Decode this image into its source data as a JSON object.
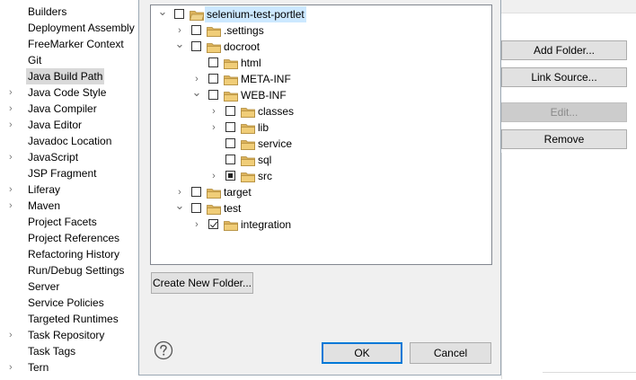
{
  "preferences": {
    "items": [
      {
        "label": "Builders",
        "expandable": false,
        "selected": false
      },
      {
        "label": "Deployment Assembly",
        "expandable": false,
        "selected": false
      },
      {
        "label": "FreeMarker Context",
        "expandable": false,
        "selected": false
      },
      {
        "label": "Git",
        "expandable": false,
        "selected": false
      },
      {
        "label": "Java Build Path",
        "expandable": false,
        "selected": true
      },
      {
        "label": "Java Code Style",
        "expandable": true,
        "selected": false
      },
      {
        "label": "Java Compiler",
        "expandable": true,
        "selected": false
      },
      {
        "label": "Java Editor",
        "expandable": true,
        "selected": false
      },
      {
        "label": "Javadoc Location",
        "expandable": false,
        "selected": false
      },
      {
        "label": "JavaScript",
        "expandable": true,
        "selected": false
      },
      {
        "label": "JSP Fragment",
        "expandable": false,
        "selected": false
      },
      {
        "label": "Liferay",
        "expandable": true,
        "selected": false
      },
      {
        "label": "Maven",
        "expandable": true,
        "selected": false
      },
      {
        "label": "Project Facets",
        "expandable": false,
        "selected": false
      },
      {
        "label": "Project References",
        "expandable": false,
        "selected": false
      },
      {
        "label": "Refactoring History",
        "expandable": false,
        "selected": false
      },
      {
        "label": "Run/Debug Settings",
        "expandable": false,
        "selected": false
      },
      {
        "label": "Server",
        "expandable": false,
        "selected": false
      },
      {
        "label": "Service Policies",
        "expandable": false,
        "selected": false
      },
      {
        "label": "Targeted Runtimes",
        "expandable": false,
        "selected": false
      },
      {
        "label": "Task Repository",
        "expandable": true,
        "selected": false
      },
      {
        "label": "Task Tags",
        "expandable": false,
        "selected": false
      },
      {
        "label": "Tern",
        "expandable": true,
        "selected": false
      }
    ]
  },
  "source_buttons": {
    "add_folder": "Add Folder...",
    "link_source": "Link Source...",
    "edit": "Edit...",
    "remove": "Remove"
  },
  "folder_tree": {
    "rows": [
      {
        "name": "selenium-test-portlet",
        "depth": 0,
        "twisty": "expanded",
        "check": "unchecked",
        "icon": "project-folder-icon",
        "selected": true
      },
      {
        "name": ".settings",
        "depth": 1,
        "twisty": "collapsed",
        "check": "unchecked",
        "icon": "folder-icon",
        "selected": false
      },
      {
        "name": "docroot",
        "depth": 1,
        "twisty": "expanded",
        "check": "unchecked",
        "icon": "folder-icon",
        "selected": false
      },
      {
        "name": "html",
        "depth": 2,
        "twisty": "none",
        "check": "unchecked",
        "icon": "folder-icon",
        "selected": false
      },
      {
        "name": "META-INF",
        "depth": 2,
        "twisty": "collapsed",
        "check": "unchecked",
        "icon": "folder-icon",
        "selected": false
      },
      {
        "name": "WEB-INF",
        "depth": 2,
        "twisty": "expanded",
        "check": "unchecked",
        "icon": "folder-icon",
        "selected": false
      },
      {
        "name": "classes",
        "depth": 3,
        "twisty": "collapsed",
        "check": "unchecked",
        "icon": "folder-icon",
        "selected": false
      },
      {
        "name": "lib",
        "depth": 3,
        "twisty": "collapsed",
        "check": "unchecked",
        "icon": "folder-icon",
        "selected": false
      },
      {
        "name": "service",
        "depth": 3,
        "twisty": "none",
        "check": "unchecked",
        "icon": "folder-icon",
        "selected": false
      },
      {
        "name": "sql",
        "depth": 3,
        "twisty": "none",
        "check": "unchecked",
        "icon": "folder-icon",
        "selected": false
      },
      {
        "name": "src",
        "depth": 3,
        "twisty": "collapsed",
        "check": "partial",
        "icon": "folder-icon",
        "selected": false
      },
      {
        "name": "target",
        "depth": 1,
        "twisty": "collapsed",
        "check": "unchecked",
        "icon": "folder-icon",
        "selected": false
      },
      {
        "name": "test",
        "depth": 1,
        "twisty": "expanded",
        "check": "unchecked",
        "icon": "folder-icon",
        "selected": false
      },
      {
        "name": "integration",
        "depth": 2,
        "twisty": "collapsed",
        "check": "checked",
        "icon": "folder-icon",
        "selected": false
      }
    ]
  },
  "dialog": {
    "create_new_folder": "Create New Folder...",
    "ok": "OK",
    "cancel": "Cancel"
  },
  "colors": {
    "selection": "#cce8ff",
    "folder": "#dcb35c",
    "accent": "#0078d7"
  }
}
